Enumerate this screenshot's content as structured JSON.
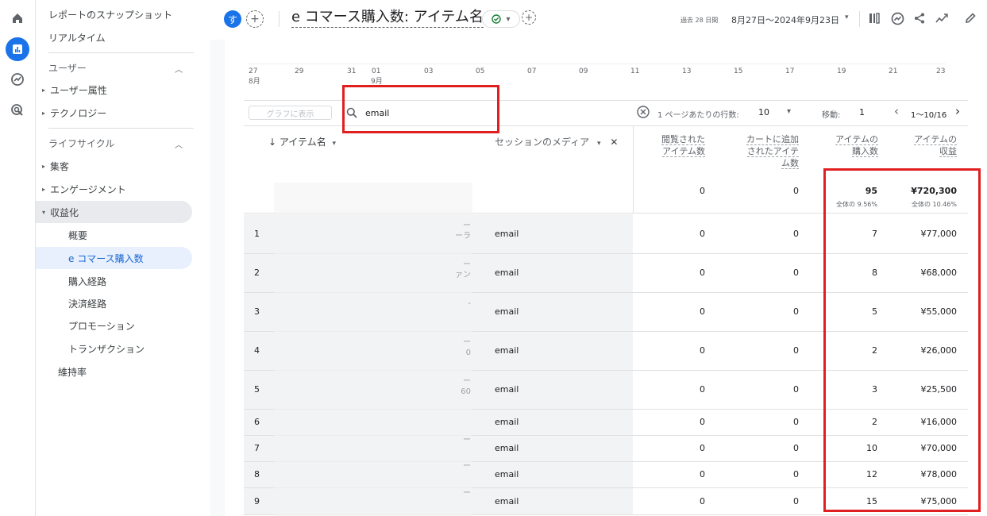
{
  "sidebar": {
    "top_items": [
      "レポートのスナップショット",
      "リアルタイム"
    ],
    "section_user": "ユーザー",
    "user_items": [
      "ユーザー属性",
      "テクノロジー"
    ],
    "section_lifecycle": "ライフサイクル",
    "lifecycle_items": [
      "集客",
      "エンゲージメント",
      "収益化"
    ],
    "monetization_subitems": [
      "概要",
      "e コマース購入数",
      "購入経路",
      "決済経路",
      "プロモーション",
      "トランザクション"
    ],
    "retention": "維持率"
  },
  "header": {
    "avatar_letter": "す",
    "title": "e コマース購入数: アイテム名",
    "date_range_prefix": "過去 28 日間",
    "date_range": "8月27日～2024年9月23日"
  },
  "chart_axis": {
    "ticks": [
      "27",
      "29",
      "31",
      "01",
      "03",
      "05",
      "07",
      "09",
      "11",
      "13",
      "15",
      "17",
      "19",
      "21",
      "23"
    ],
    "month_labels": [
      "8月",
      "9月"
    ]
  },
  "toolbar": {
    "plot_button": "グラフに表示",
    "search_value": "email",
    "rows_per_page_label": "1 ページあたりの行数:",
    "rows_per_page": "10",
    "goto_label": "移動:",
    "goto_value": "1",
    "pagination": "1～10/16"
  },
  "table": {
    "columns": {
      "item_name": "アイテム名",
      "session_medium": "セッションのメディア",
      "items_viewed": [
        "閲覧された",
        "アイテム数"
      ],
      "items_added": [
        "カートに追加",
        "されたアイテ",
        "ム数"
      ],
      "items_purchased": [
        "アイテムの",
        "購入数"
      ],
      "item_revenue": [
        "アイテムの",
        "収益"
      ]
    },
    "totals": {
      "items_viewed": "0",
      "items_added": "0",
      "items_purchased": "95",
      "items_purchased_pct": "全体の 9.56%",
      "item_revenue": "¥720,300",
      "item_revenue_pct": "全体の 10.46%"
    },
    "rows": [
      {
        "idx": "1",
        "frag": "ー\nーラ",
        "medium": "email",
        "viewed": "0",
        "added": "0",
        "purchased": "7",
        "revenue": "¥77,000"
      },
      {
        "idx": "2",
        "frag": "ー\nァン",
        "medium": "email",
        "viewed": "0",
        "added": "0",
        "purchased": "8",
        "revenue": "¥68,000"
      },
      {
        "idx": "3",
        "frag": "-",
        "medium": "email",
        "viewed": "0",
        "added": "0",
        "purchased": "5",
        "revenue": "¥55,000"
      },
      {
        "idx": "4",
        "frag": "ー\n0",
        "medium": "email",
        "viewed": "0",
        "added": "0",
        "purchased": "2",
        "revenue": "¥26,000"
      },
      {
        "idx": "5",
        "frag": "ー\n60",
        "medium": "email",
        "viewed": "0",
        "added": "0",
        "purchased": "3",
        "revenue": "¥25,500"
      },
      {
        "idx": "6",
        "frag": "",
        "medium": "email",
        "viewed": "0",
        "added": "0",
        "purchased": "2",
        "revenue": "¥16,000"
      },
      {
        "idx": "7",
        "frag": "ー",
        "medium": "email",
        "viewed": "0",
        "added": "0",
        "purchased": "10",
        "revenue": "¥70,000"
      },
      {
        "idx": "8",
        "frag": "ー",
        "medium": "email",
        "viewed": "0",
        "added": "0",
        "purchased": "12",
        "revenue": "¥78,000"
      },
      {
        "idx": "9",
        "frag": "ー",
        "medium": "email",
        "viewed": "0",
        "added": "0",
        "purchased": "15",
        "revenue": "¥75,000"
      }
    ]
  },
  "colors": {
    "accent": "#1a73e8",
    "highlight": "#e02020",
    "active_nav_bg": "#e8f0fe"
  }
}
